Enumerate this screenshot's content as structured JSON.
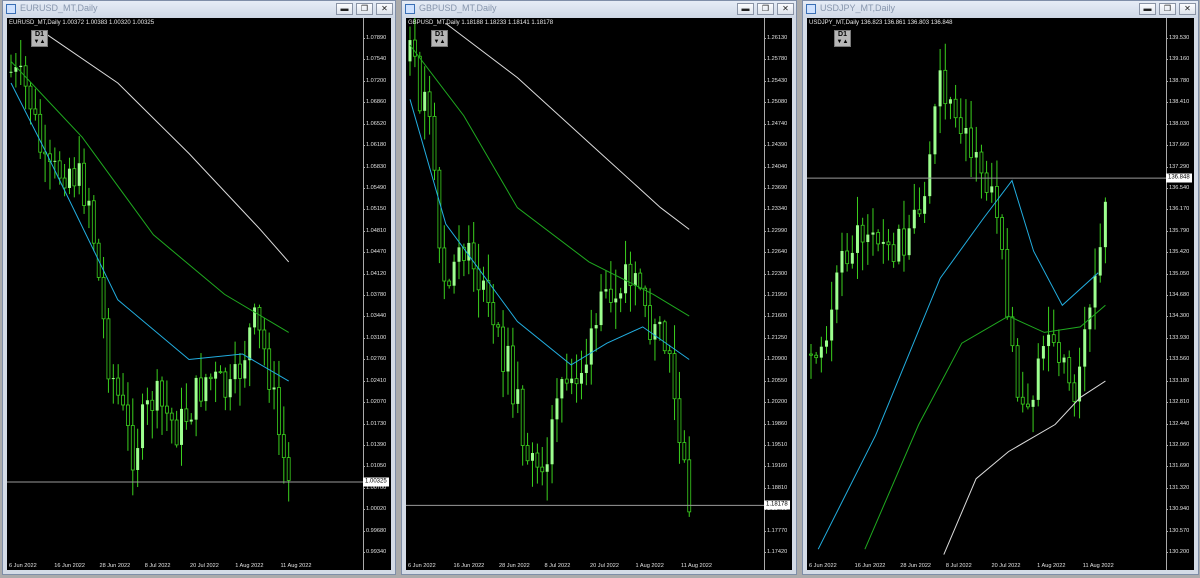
{
  "charts": [
    {
      "title": "EURUSD_MT,Daily",
      "header": "EURUSD_MT,Daily  1.00372 1.00383 1.00320 1.00325",
      "timeframe": "D1",
      "tf_arrows": "▼▲",
      "current_price": "1.00325",
      "price_min": 0.99,
      "price_max": 1.082,
      "current_value": 1.00325,
      "price_ticks": [
        "1.07890",
        "1.07540",
        "1.07200",
        "1.06860",
        "1.06520",
        "1.06180",
        "1.05830",
        "1.05490",
        "1.05150",
        "1.04810",
        "1.04470",
        "1.04120",
        "1.03780",
        "1.03440",
        "1.03100",
        "1.02760",
        "1.02410",
        "1.02070",
        "1.01730",
        "1.01390",
        "1.01050",
        "1.00700",
        "1.00020",
        "0.99680",
        "0.99340"
      ],
      "date_ticks": [
        "6 Jun 2022",
        "16 Jun 2022",
        "28 Jun 2022",
        "8 Jul 2022",
        "20 Jul 2022",
        "1 Aug 2022",
        "11 Aug 2022"
      ]
    },
    {
      "title": "GBPUSD_MT,Daily",
      "header": "GBPUSD_MT,Daily  1.18188 1.18233 1.18141 1.18178",
      "timeframe": "D1",
      "tf_arrows": "▼▲",
      "current_price": "1.18178",
      "price_min": 1.1725,
      "price_max": 1.2645,
      "current_value": 1.18178,
      "price_ticks": [
        "1.26130",
        "1.25780",
        "1.25430",
        "1.25080",
        "1.24740",
        "1.24390",
        "1.24040",
        "1.23690",
        "1.23340",
        "1.22990",
        "1.22640",
        "1.22300",
        "1.21950",
        "1.21600",
        "1.21250",
        "1.20900",
        "1.20550",
        "1.20200",
        "1.19860",
        "1.19510",
        "1.19160",
        "1.18810",
        "1.18460",
        "1.17770",
        "1.17420"
      ],
      "date_ticks": [
        "6 Jun 2022",
        "16 Jun 2022",
        "28 Jun 2022",
        "8 Jul 2022",
        "20 Jul 2022",
        "1 Aug 2022",
        "11 Aug 2022"
      ]
    },
    {
      "title": "USDJPY_MT,Daily",
      "header": "USDJPY_MT,Daily  136.823 136.861 136.803 136.848",
      "timeframe": "D1",
      "tf_arrows": "▼▲",
      "current_price": "136.848",
      "price_min": 130.05,
      "price_max": 139.7,
      "current_value": 136.848,
      "price_ticks": [
        "139.530",
        "139.160",
        "138.780",
        "138.410",
        "138.030",
        "137.660",
        "137.290",
        "136.540",
        "136.170",
        "135.790",
        "135.420",
        "135.050",
        "134.680",
        "134.300",
        "133.930",
        "133.560",
        "133.180",
        "132.810",
        "132.440",
        "132.060",
        "131.690",
        "131.320",
        "130.940",
        "130.570",
        "130.200"
      ],
      "date_ticks": [
        "6 Jun 2022",
        "16 Jun 2022",
        "28 Jun 2022",
        "8 Jul 2022",
        "20 Jul 2022",
        "1 Aug 2022",
        "11 Aug 2022"
      ]
    }
  ],
  "colors": {
    "candle": "#9dff8f",
    "wick": "#3bd11e",
    "ma_fast": "#22aee0",
    "ma_mid": "#1faa1f",
    "ma_slow": "#dcdcdc",
    "price_line": "#9a9a9a"
  },
  "window_buttons": {
    "minimize": "▬",
    "restore": "❐",
    "close": "✕"
  }
}
